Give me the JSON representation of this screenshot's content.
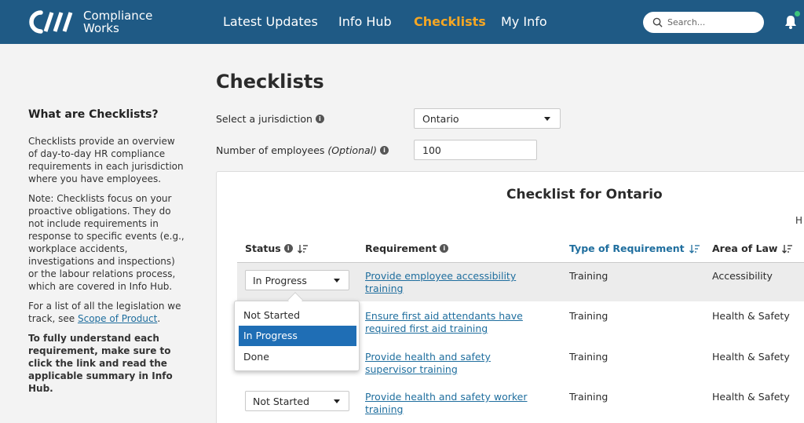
{
  "brand": {
    "line1": "Compliance",
    "line2": "Works",
    "accent": "#f5a623",
    "header_bg": "#1f5a85"
  },
  "nav": {
    "items": [
      {
        "label": "Latest Updates"
      },
      {
        "label": "Info Hub"
      },
      {
        "label": "Checklists",
        "active": true
      },
      {
        "label": "My Info"
      }
    ]
  },
  "search": {
    "placeholder": "Search..."
  },
  "sidebar": {
    "heading": "What are Checklists?",
    "para1": "Checklists provide an overview of day-to-day HR compliance requirements in each jurisdiction where you have employees.",
    "para2": "Note: Checklists focus on your proactive obligations. They do not include requirements in response to specific events (e.g., workplace accidents, investigations and inspections) or the labour relations process, which are covered in Info Hub.",
    "para3_prefix": "For a list of all the legislation we track, see ",
    "para3_link": "Scope of Product",
    "para3_suffix": ".",
    "para4": "To fully understand each requirement, make sure to click the link and read the applicable summary in Info Hub."
  },
  "page": {
    "title": "Checklists",
    "jurisdiction_label": "Select a jurisdiction",
    "jurisdiction_value": "Ontario",
    "employees_label": "Number of employees",
    "employees_optional": "(Optional)",
    "employees_value": "100"
  },
  "checklist": {
    "title": "Checklist for Ontario",
    "cut_text": "H",
    "columns": {
      "status": "Status",
      "requirement": "Requirement",
      "type": "Type of Requirement",
      "area": "Area of Law"
    },
    "rows": [
      {
        "status": "In Progress",
        "requirement": "Provide employee accessibility training",
        "type": "Training",
        "area": "Accessibility"
      },
      {
        "status": "",
        "requirement": "Ensure first aid attendants have required first aid training",
        "type": "Training",
        "area": "Health & Safety"
      },
      {
        "status": "",
        "requirement": "Provide health and safety supervisor training",
        "type": "Training",
        "area": "Health & Safety"
      },
      {
        "status": "Not Started",
        "requirement": "Provide health and safety worker training",
        "type": "Training",
        "area": "Health & Safety"
      }
    ],
    "status_options": [
      "Not Started",
      "In Progress",
      "Done"
    ],
    "selected_option": "In Progress"
  }
}
